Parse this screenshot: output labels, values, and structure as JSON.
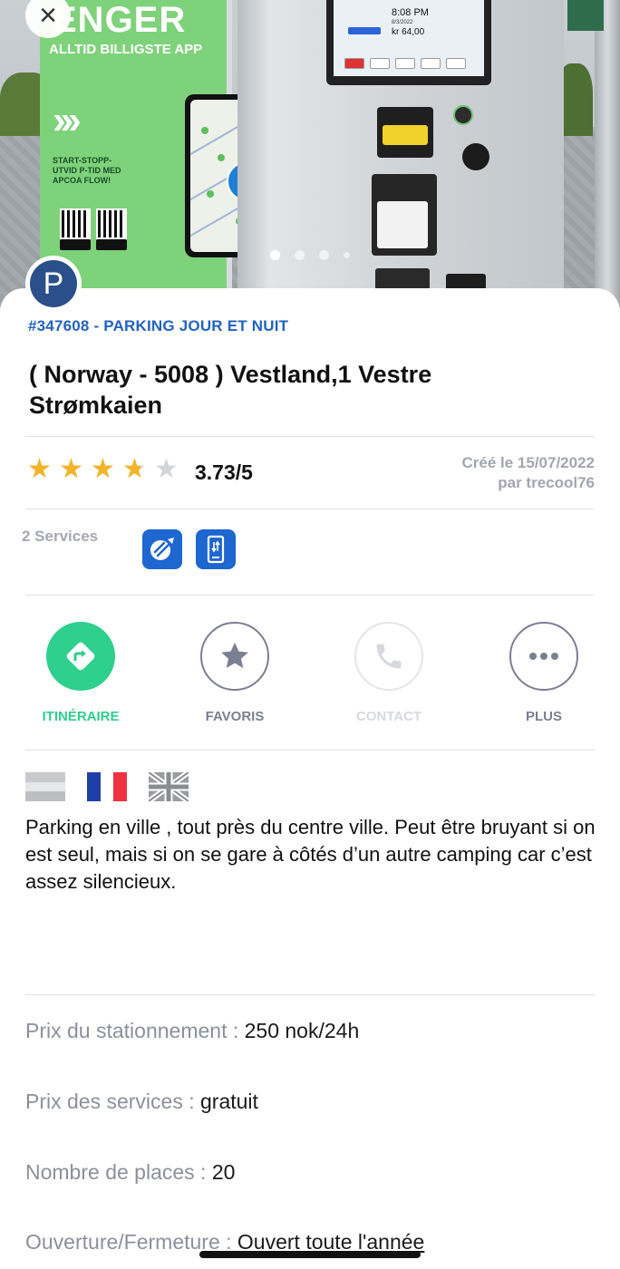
{
  "photo": {
    "poster_headline": "ENGER",
    "poster_subtitle": "ALLTID BILLIGSTE APP",
    "poster_steps": "START-STOPP-UTVID P-TID MED APCOA FLOW!",
    "machine_time": "8:08 PM",
    "machine_date": "8/3/2022",
    "machine_amount": "kr 64,00",
    "carousel_count": 4,
    "carousel_active": 0
  },
  "header": {
    "close_icon": "close-icon",
    "parking_icon_letter": "P"
  },
  "place": {
    "id_line": "#347608 - PARKING JOUR ET NUIT",
    "title": "( Norway - 5008 ) Vestland,1 Vestre Strømkaien"
  },
  "rating": {
    "value": 3.73,
    "max": 5,
    "display": "3.73/5",
    "star_color": "#f3b428"
  },
  "created": {
    "line1": "Créé le 15/07/2022",
    "line2": "par trecool76"
  },
  "services": {
    "label": "2 Services",
    "icons": [
      "parking-permit-icon",
      "mobile-payment-icon"
    ],
    "color": "#1e66d0"
  },
  "actions": [
    {
      "label": "ITINÉRAIRE",
      "icon": "directions-icon",
      "color": "#2fcf8d"
    },
    {
      "label": "FAVORIS",
      "icon": "star-icon",
      "color": "#7a7f91"
    },
    {
      "label": "CONTACT",
      "icon": "phone-icon",
      "color": "#d7d9de"
    },
    {
      "label": "PLUS",
      "icon": "more-icon",
      "color": "#7a7f91"
    }
  ],
  "languages": [
    "generic-flag-icon",
    "france-flag-icon",
    "uk-flag-icon"
  ],
  "description": "Parking en ville , tout près du centre ville. Peut être bruyant si on est seul, mais si on se gare à côtés d’un autre camping car c’est assez silencieux.",
  "info": {
    "price_label": "Prix du stationnement : ",
    "price_value": "250 nok/24h",
    "services_label": "Prix des services : ",
    "services_value": "gratuit",
    "places_label": "Nombre de places : ",
    "places_value": "20",
    "opening_label": "Ouverture/Fermeture : ",
    "opening_value": "Ouvert toute l'année"
  }
}
